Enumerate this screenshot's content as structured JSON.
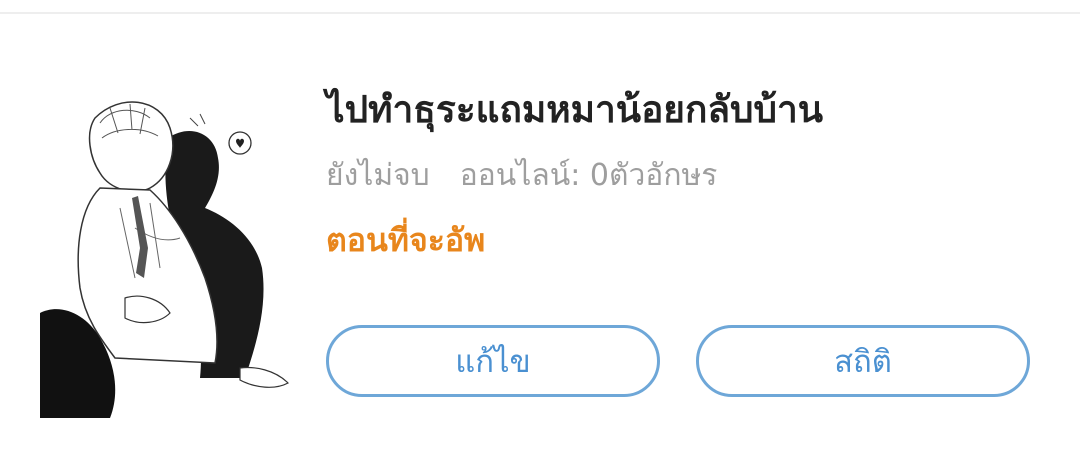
{
  "story": {
    "title": "ไปทำธุระแถมหมาน้อยกลับบ้าน",
    "status": "ยังไม่จบ",
    "online_label": "ออนไลน์: 0ตัวอักษร",
    "upcoming_label": "ตอนที่จะอัพ"
  },
  "actions": {
    "edit_label": "แก้ไข",
    "stats_label": "สถิติ"
  },
  "colors": {
    "accent_orange": "#e8861c",
    "button_blue": "#4a90d1",
    "button_border": "#6ea7d8"
  }
}
